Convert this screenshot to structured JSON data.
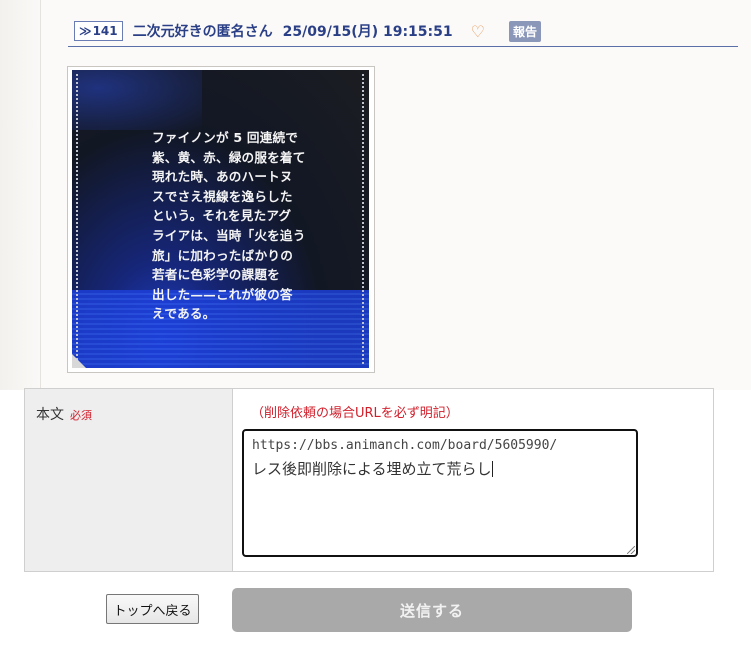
{
  "post": {
    "res_arrow": "≫",
    "res_number": "141",
    "poster_name": "二次元好きの匿名さん",
    "date": "25/09/15(月) 19:15:51",
    "heart": "♡",
    "report_label": "報告",
    "image_text_lines": [
      "ファイノンが 5 回連続で",
      "紫、黄、赤、緑の服を着て",
      "現れた時、あのハートヌ",
      "スでさえ視線を逸らした",
      "という。それを見たアグ",
      "ライアは、当時「火を追う",
      "旅」に加わったばかりの",
      "若者に色彩学の課題を",
      "出した——これが彼の答",
      "えである。"
    ]
  },
  "form": {
    "body_label": "本文",
    "required_label": "必須",
    "note": "（削除依頼の場合URLを必ず明記）",
    "textarea_line1": "https://bbs.animanch.com/board/5605990/",
    "textarea_line2": "レス後即削除による埋め立て荒らし"
  },
  "buttons": {
    "back_label": "トップへ戻る",
    "submit_label": "送信する"
  },
  "colors": {
    "header_text": "#2a3f86",
    "required": "#d0202c",
    "submit_disabled": "#a9a9a9"
  }
}
